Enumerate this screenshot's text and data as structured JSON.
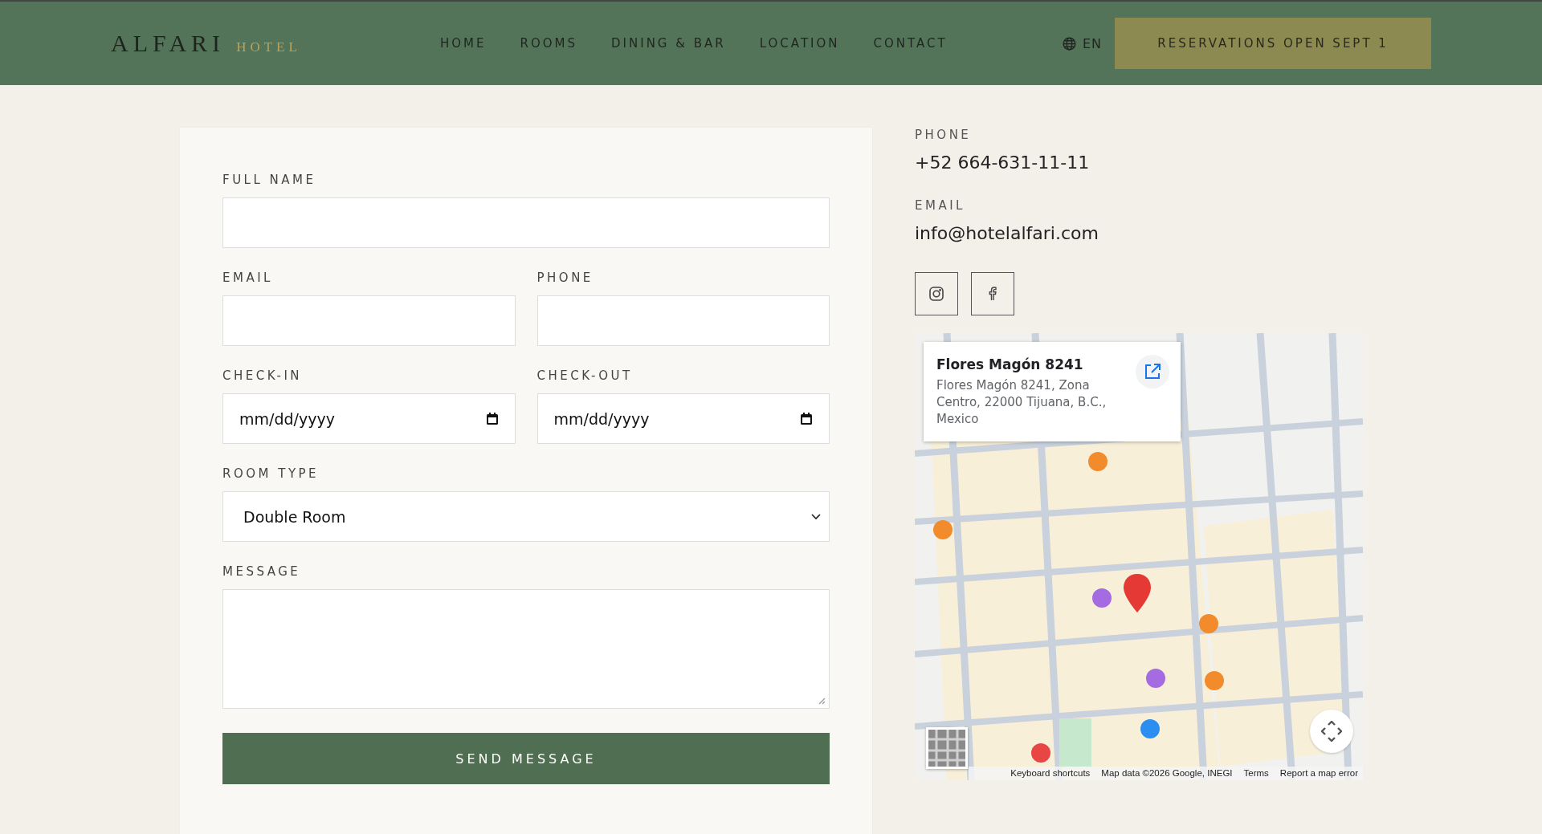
{
  "header": {
    "logo": {
      "name": "ALFARI",
      "suffix": "HOTEL"
    },
    "nav": [
      {
        "label": "HOME"
      },
      {
        "label": "ROOMS"
      },
      {
        "label": "DINING & BAR"
      },
      {
        "label": "LOCATION"
      },
      {
        "label": "CONTACT"
      }
    ],
    "language": "EN",
    "cta": "RESERVATIONS OPEN SEPT 1"
  },
  "form": {
    "rows": [
      [
        {
          "label": "FULL NAME",
          "kind": "text"
        }
      ],
      [
        {
          "label": "EMAIL",
          "kind": "text"
        },
        {
          "label": "PHONE",
          "kind": "text"
        }
      ],
      [
        {
          "label": "CHECK-IN",
          "kind": "date",
          "value": "mm/dd/yyyy"
        },
        {
          "label": "CHECK-OUT",
          "kind": "date",
          "value": "mm/dd/yyyy"
        }
      ],
      [
        {
          "label": "ROOM TYPE",
          "kind": "select",
          "value": "Double Room"
        }
      ],
      [
        {
          "label": "MESSAGE",
          "kind": "textarea"
        }
      ]
    ],
    "submit": "SEND MESSAGE"
  },
  "contact": [
    {
      "label": "PHONE",
      "value": "+52 664-631-11-11"
    },
    {
      "label": "EMAIL",
      "value": "info@hotelalfari.com"
    }
  ],
  "social": [
    {
      "kind": "instagram"
    },
    {
      "kind": "facebook"
    }
  ],
  "map": {
    "kind": "picture",
    "place": {
      "title": "Flores Magón 8241",
      "address": "Flores Magón 8241, Zona Centro, 22000 Tijuana, B.C., Mexico"
    },
    "attribution": [
      "Keyboard shortcuts",
      "Map data ©2026 Google, INEGI",
      "Terms",
      "Report a map error"
    ]
  }
}
